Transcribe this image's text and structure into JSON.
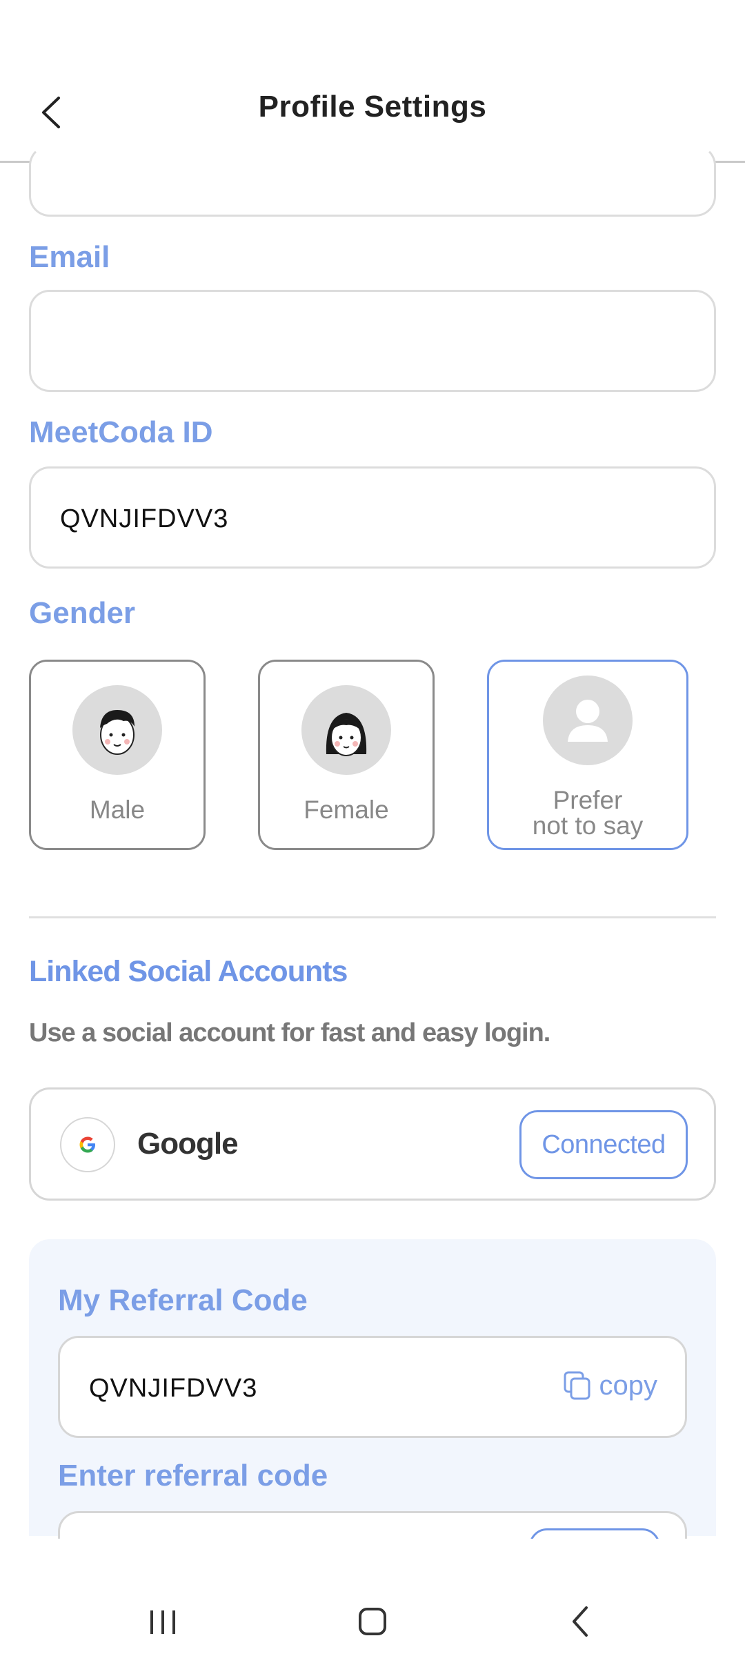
{
  "header": {
    "title": "Profile Settings"
  },
  "email": {
    "label": "Email",
    "value": ""
  },
  "meetcoda": {
    "label": "MeetCoda ID",
    "value": "QVNJIFDVV3"
  },
  "gender": {
    "label": "Gender",
    "options": [
      {
        "label": "Male"
      },
      {
        "label": "Female"
      },
      {
        "label_line1": "Prefer",
        "label_line2": "not to say",
        "selected": true
      }
    ]
  },
  "social": {
    "title": "Linked Social Accounts",
    "subtitle": "Use a social account for fast and easy login.",
    "google": {
      "name": "Google",
      "status": "Connected"
    }
  },
  "referral": {
    "my_label": "My Referral Code",
    "my_code": "QVNJIFDVV3",
    "copy_label": "copy",
    "enter_label": "Enter referral code"
  },
  "colors": {
    "accent": "#6f95e6",
    "label": "#7b9ee6",
    "panel": "#f2f6fd"
  }
}
